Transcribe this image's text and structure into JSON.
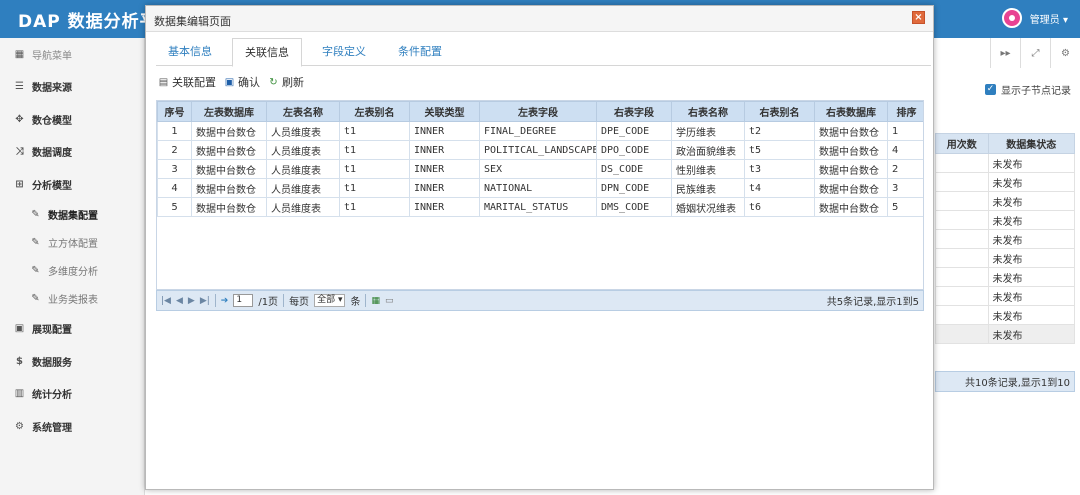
{
  "app": {
    "brand": "DAP 数据分析平",
    "user": "管理员 ▾"
  },
  "sidebar": {
    "items": [
      {
        "label": "导航菜单",
        "icon": "grid",
        "type": "nav"
      },
      {
        "label": "数据来源",
        "icon": "database",
        "type": "main"
      },
      {
        "label": "数仓模型",
        "icon": "cubes",
        "type": "main"
      },
      {
        "label": "数据调度",
        "icon": "shuffle",
        "type": "main"
      },
      {
        "label": "分析模型",
        "icon": "chart-model",
        "type": "main"
      },
      {
        "label": "数据集配置",
        "icon": "wrench",
        "type": "sub-active"
      },
      {
        "label": "立方体配置",
        "icon": "wrench",
        "type": "sub"
      },
      {
        "label": "多维度分析",
        "icon": "wrench",
        "type": "sub"
      },
      {
        "label": "业务类报表",
        "icon": "wrench",
        "type": "sub"
      },
      {
        "label": "展现配置",
        "icon": "film",
        "type": "main"
      },
      {
        "label": "数据服务",
        "icon": "dollar",
        "type": "main"
      },
      {
        "label": "统计分析",
        "icon": "bar-chart",
        "type": "main"
      },
      {
        "label": "系统管理",
        "icon": "gear",
        "type": "main"
      }
    ]
  },
  "background": {
    "show_child_label": "显示子节点记录",
    "table_headers": [
      "用次数",
      "数据集状态"
    ],
    "rows": [
      "未发布",
      "未发布",
      "未发布",
      "未发布",
      "未发布",
      "未发布",
      "未发布",
      "未发布",
      "未发布",
      "未发布"
    ],
    "pager_info": "共10条记录,显示1到10"
  },
  "modal": {
    "title": "数据集编辑页面",
    "tabs": [
      "基本信息",
      "关联信息",
      "字段定义",
      "条件配置"
    ],
    "active_tab": 1,
    "toolbar": {
      "config": "关联配置",
      "confirm": "确认",
      "refresh": "刷新"
    },
    "columns": [
      "序号",
      "左表数据库",
      "左表名称",
      "左表别名",
      "关联类型",
      "左表字段",
      "右表字段",
      "右表名称",
      "右表别名",
      "右表数据库",
      "排序"
    ],
    "rows": [
      [
        "1",
        "数据中台数仓",
        "人员维度表",
        "t1",
        "INNER",
        "FINAL_DEGREE",
        "DPE_CODE",
        "学历维表",
        "t2",
        "数据中台数仓",
        "1"
      ],
      [
        "2",
        "数据中台数仓",
        "人员维度表",
        "t1",
        "INNER",
        "POLITICAL_LANDSCAPE",
        "DPO_CODE",
        "政治面貌维表",
        "t5",
        "数据中台数仓",
        "4"
      ],
      [
        "3",
        "数据中台数仓",
        "人员维度表",
        "t1",
        "INNER",
        "SEX",
        "DS_CODE",
        "性别维表",
        "t3",
        "数据中台数仓",
        "2"
      ],
      [
        "4",
        "数据中台数仓",
        "人员维度表",
        "t1",
        "INNER",
        "NATIONAL",
        "DPN_CODE",
        "民族维表",
        "t4",
        "数据中台数仓",
        "3"
      ],
      [
        "5",
        "数据中台数仓",
        "人员维度表",
        "t1",
        "INNER",
        "MARITAL_STATUS",
        "DMS_CODE",
        "婚姻状况维表",
        "t6",
        "数据中台数仓",
        "5"
      ]
    ],
    "pager": {
      "page_value": "1",
      "total_pages": "/1页",
      "per_page_label": "每页",
      "per_page_value": "全部",
      "unit": "条",
      "info": "共5条记录,显示1到5"
    }
  }
}
